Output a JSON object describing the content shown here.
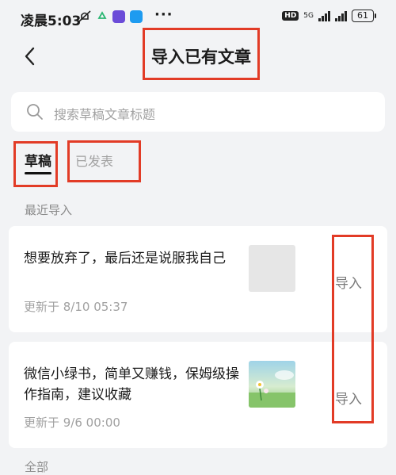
{
  "status": {
    "time": "凌晨5:03",
    "dots": "···",
    "hd": "HD",
    "network": "5G",
    "battery": "61"
  },
  "header": {
    "title": "导入已有文章"
  },
  "search": {
    "placeholder": "搜索草稿文章标题"
  },
  "tabs": [
    {
      "label": "草稿"
    },
    {
      "label": "已发表"
    }
  ],
  "section": {
    "label": "最近导入"
  },
  "articles": [
    {
      "title": "想要放弃了，最后还是说服我自己",
      "updated": "更新于 8/10 05:37",
      "import_label": "导入"
    },
    {
      "title": "微信小绿书，简单又赚钱，保姆级操作指南，建议收藏",
      "updated": "更新于 9/6 00:00",
      "import_label": "导入"
    }
  ],
  "footer_peek": "全部"
}
